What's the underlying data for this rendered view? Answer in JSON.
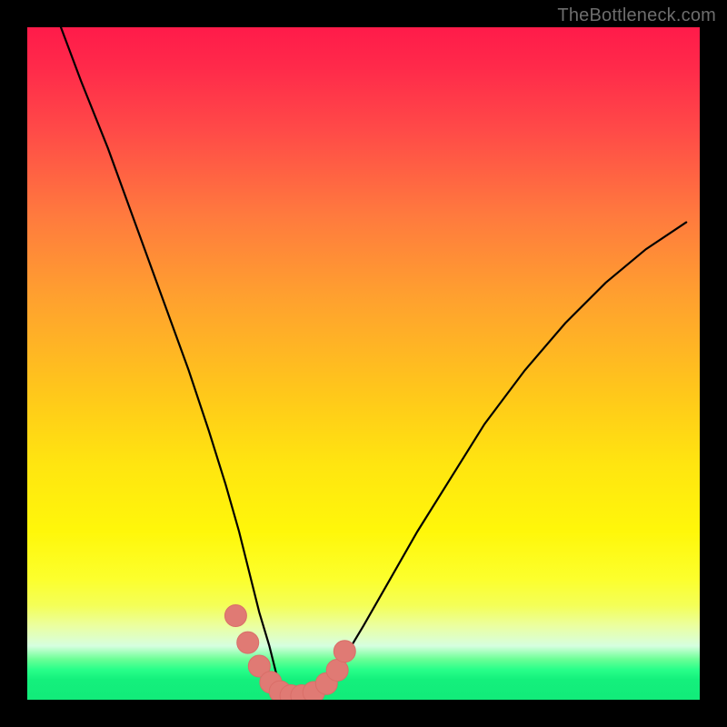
{
  "watermark": "TheBottleneck.com",
  "colors": {
    "background": "#000000",
    "curve": "#000000",
    "marker_fill": "#e07a74",
    "marker_stroke": "#d96e68"
  },
  "chart_data": {
    "type": "line",
    "title": "",
    "xlabel": "",
    "ylabel": "",
    "xlim": [
      0,
      100
    ],
    "ylim": [
      0,
      100
    ],
    "grid": false,
    "legend": false,
    "series": [
      {
        "name": "bottleneck-curve",
        "x": [
          5,
          8,
          12,
          16,
          20,
          24,
          27,
          29.5,
          31.5,
          33,
          34.5,
          36,
          37,
          38,
          39,
          40,
          42,
          44,
          47,
          50,
          54,
          58,
          63,
          68,
          74,
          80,
          86,
          92,
          98
        ],
        "y": [
          100,
          92,
          82,
          71,
          60,
          49,
          40,
          32,
          25,
          19,
          13,
          8,
          4,
          1.5,
          0.5,
          0.5,
          0.6,
          2,
          6,
          11,
          18,
          25,
          33,
          41,
          49,
          56,
          62,
          67,
          71
        ]
      }
    ],
    "markers": {
      "name": "highlighted-points",
      "x": [
        31.0,
        32.8,
        34.5,
        36.2,
        37.6,
        39.2,
        40.8,
        42.6,
        44.5,
        46.1,
        47.2
      ],
      "y": [
        12.5,
        8.5,
        5.0,
        2.6,
        1.2,
        0.6,
        0.6,
        1.1,
        2.4,
        4.4,
        7.2
      ]
    }
  }
}
